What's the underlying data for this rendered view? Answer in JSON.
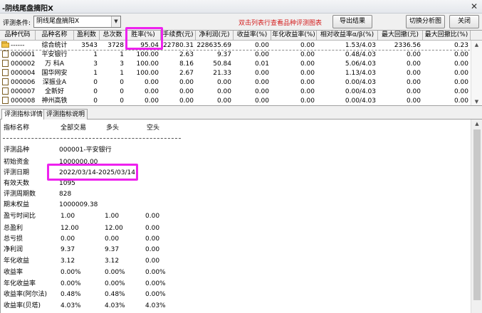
{
  "window": {
    "title": "-阴线尾盘摘阳X",
    "close_glyph": "✕"
  },
  "toolbar": {
    "label": "评测条件:",
    "condition_value": "阴线尾盘摘阳X",
    "notice": "双击列表行查看品种评测图表",
    "export_label": "导出结果",
    "switch_chart_label": "切换分析图",
    "close_label": "关闭"
  },
  "grid": {
    "columns": [
      "品种代码",
      "品种名称",
      "盈利数",
      "总次数",
      "胜率(%)",
      "手续费(元)",
      "净利润(元)",
      "收益率(%)",
      "年化收益率(%)",
      "相对收益率α/β(%)",
      "最大回撤(元)",
      "最大回撤比(%)"
    ],
    "rows": [
      [
        "------",
        "综合统计",
        "3543",
        "3728",
        "95.04",
        "22780.31",
        "228635.69",
        "0.00",
        "0.00",
        "1.53/4.03",
        "2336.56",
        "0.23"
      ],
      [
        "000001",
        "平安银行",
        "1",
        "1",
        "100.00",
        "2.63",
        "9.37",
        "0.00",
        "0.00",
        "0.48/4.03",
        "0.00",
        "0.00"
      ],
      [
        "000002",
        "万 科A",
        "3",
        "3",
        "100.00",
        "8.16",
        "50.84",
        "0.01",
        "0.00",
        "5.06/4.03",
        "0.00",
        "0.00"
      ],
      [
        "000004",
        "国华网安",
        "1",
        "1",
        "100.00",
        "2.67",
        "21.33",
        "0.00",
        "0.00",
        "1.13/4.03",
        "0.00",
        "0.00"
      ],
      [
        "000006",
        "深振业A",
        "0",
        "0",
        "0.00",
        "0.00",
        "0.00",
        "0.00",
        "0.00",
        "0.00/4.03",
        "0.00",
        "0.00"
      ],
      [
        "000007",
        "全新好",
        "0",
        "0",
        "0.00",
        "0.00",
        "0.00",
        "0.00",
        "0.00",
        "0.00/4.03",
        "0.00",
        "0.00"
      ],
      [
        "000008",
        "神州高铁",
        "0",
        "0",
        "0.00",
        "0.00",
        "0.00",
        "0.00",
        "0.00",
        "0.00/4.03",
        "0.00",
        "0.00"
      ]
    ]
  },
  "tabs": [
    {
      "label": "评测指标详情",
      "active": true
    },
    {
      "label": "评测指标说明",
      "active": false
    }
  ],
  "detail": {
    "header": {
      "name": "指标名称",
      "all": "全部交易",
      "long": "多头",
      "short": "空头"
    },
    "info": [
      {
        "label": "评测品种",
        "value": "000001-平安银行"
      },
      {
        "label": "初始资金",
        "value": "1000000.00"
      },
      {
        "label": "评测日期",
        "value": "2022/03/14-2025/03/14"
      },
      {
        "label": "有效天数",
        "value": "1095"
      },
      {
        "label": "评测周期数",
        "value": "828"
      },
      {
        "label": "期末权益",
        "value": "1000009.38"
      }
    ],
    "metrics": [
      {
        "label": "盈亏时间比",
        "all": "1.00",
        "long": "1.00",
        "short": "0.00"
      },
      {
        "label": "总盈利",
        "all": "12.00",
        "long": "12.00",
        "short": "0.00"
      },
      {
        "label": "总亏损",
        "all": "0.00",
        "long": "0.00",
        "short": "0.00"
      },
      {
        "label": "净利润",
        "all": "9.37",
        "long": "9.37",
        "short": "0.00"
      },
      {
        "label": "年化收益",
        "all": "3.12",
        "long": "3.12",
        "short": "0.00"
      },
      {
        "label": "收益率",
        "all": "0.00%",
        "long": "0.00%",
        "short": "0.00%"
      },
      {
        "label": "年化收益率",
        "all": "0.00%",
        "long": "0.00%",
        "short": "0.00%"
      },
      {
        "label": "收益率(阿尔法)",
        "all": "0.48%",
        "long": "0.48%",
        "short": "0.00%"
      },
      {
        "label": "收益率(贝塔)",
        "all": "4.03%",
        "long": "4.03%",
        "short": "4.03%"
      }
    ]
  },
  "colors": {
    "highlight": "#ee22ee",
    "notice": "#d41c1c",
    "folder": "#f2c44a"
  }
}
